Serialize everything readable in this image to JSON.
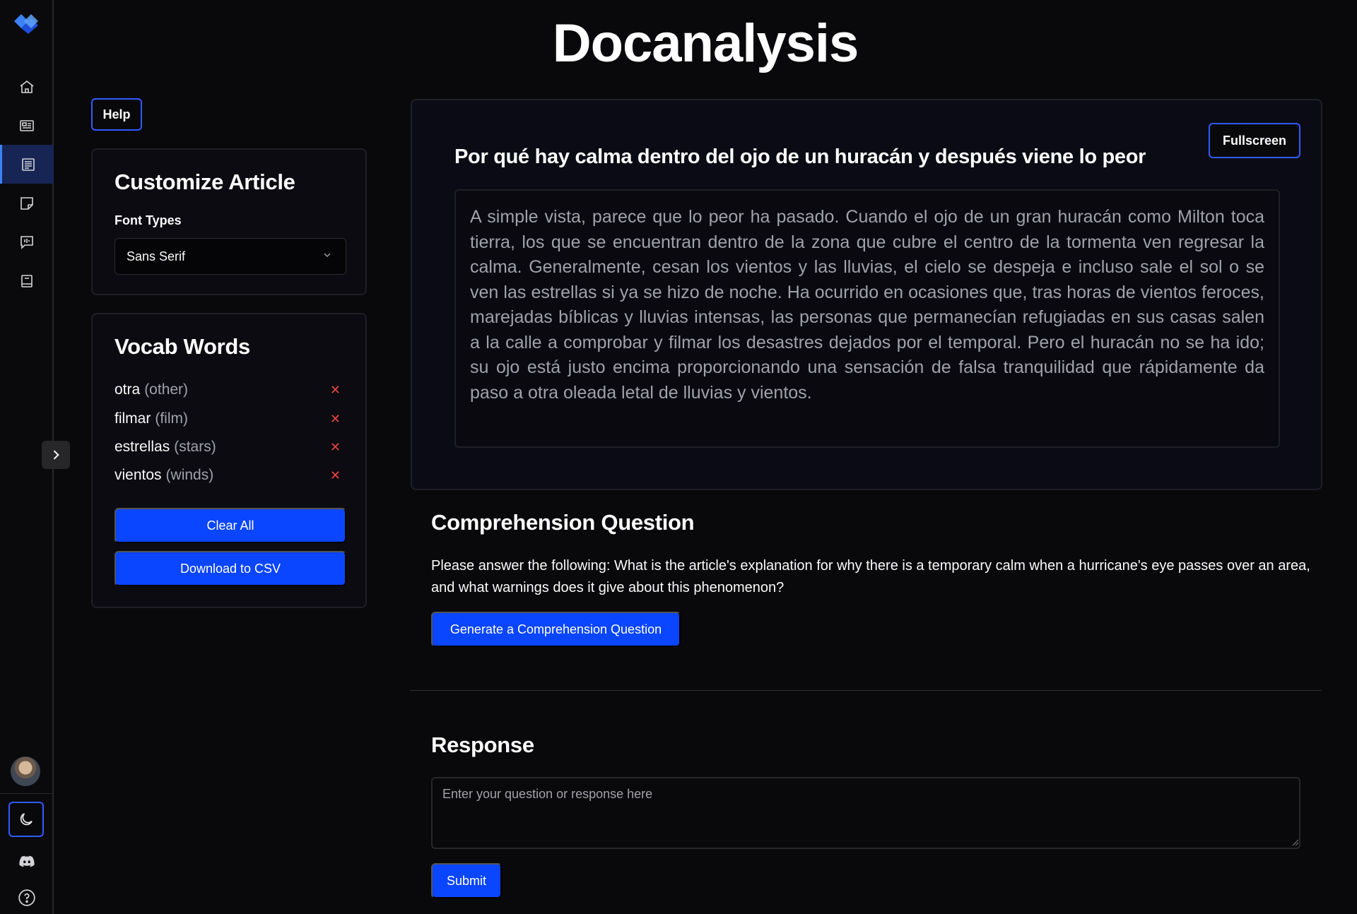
{
  "app": {
    "title": "Docanalysis"
  },
  "nav": {
    "items": [
      {
        "icon": "home-icon"
      },
      {
        "icon": "newspaper-icon"
      },
      {
        "icon": "document-icon",
        "active": true
      },
      {
        "icon": "sticky-note-icon"
      },
      {
        "icon": "chat-waveform-icon"
      },
      {
        "icon": "book-icon"
      }
    ],
    "bottom": [
      "moon-icon",
      "discord-icon",
      "help-circle-icon"
    ]
  },
  "help": {
    "label": "Help"
  },
  "customize": {
    "title": "Customize Article",
    "font_label": "Font Types",
    "font_selected": "Sans Serif"
  },
  "vocab": {
    "title": "Vocab Words",
    "words": [
      {
        "word": "otra",
        "translation": "(other)"
      },
      {
        "word": "filmar",
        "translation": "(film)"
      },
      {
        "word": "estrellas",
        "translation": "(stars)"
      },
      {
        "word": "vientos",
        "translation": "(winds)"
      }
    ],
    "remove_symbol": "✕",
    "clear_label": "Clear All",
    "download_label": "Download to CSV"
  },
  "article": {
    "fullscreen_label": "Fullscreen",
    "title": "Por qué hay calma dentro del ojo de un huracán y después viene lo peor",
    "body": "A simple vista, parece que lo peor ha pasado. Cuando el ojo de un gran huracán como Milton toca tierra, los que se encuentran dentro de la zona que cubre el centro de la tormenta ven regresar la calma. Generalmente, cesan los vientos y las lluvias, el cielo se despeja e incluso sale el sol o se ven las estrellas si ya se hizo de noche. Ha ocurrido en ocasiones que, tras horas de vientos feroces, marejadas bíblicas y lluvias intensas, las personas que permanecían refugiadas en sus casas salen a la calle a comprobar y filmar los desastres dejados por el temporal. Pero el huracán no se ha ido; su ojo está justo encima proporcionando una sensación de falsa tranquilidad que rápidamente da paso a otra oleada letal de lluvias y vientos."
  },
  "comprehension": {
    "title": "Comprehension Question",
    "question": "Please answer the following: What is the article's explanation for why there is a temporary calm when a hurricane's eye passes over an area, and what warnings does it give about this phenomenon?",
    "generate_label": "Generate a Comprehension Question"
  },
  "response": {
    "title": "Response",
    "placeholder": "Enter your question or response here",
    "value": "",
    "submit_label": "Submit"
  },
  "colors": {
    "accent": "#0a45ff",
    "outline": "#2f5bff",
    "background": "#09090b",
    "remove": "#ef4444"
  }
}
